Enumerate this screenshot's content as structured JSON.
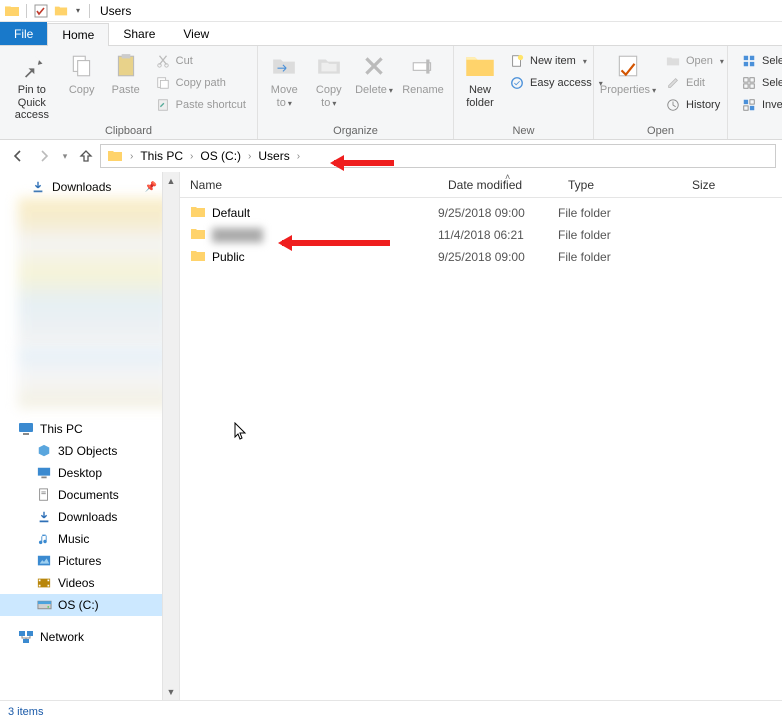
{
  "titlebar": {
    "title": "Users"
  },
  "tabs": {
    "file": "File",
    "home": "Home",
    "share": "Share",
    "view": "View"
  },
  "ribbon": {
    "clipboard": {
      "label": "Clipboard",
      "pin": "Pin to Quick access",
      "copy": "Copy",
      "paste": "Paste",
      "cut": "Cut",
      "copy_path": "Copy path",
      "paste_shortcut": "Paste shortcut"
    },
    "organize": {
      "label": "Organize",
      "move_to": "Move to",
      "copy_to": "Copy to",
      "delete": "Delete",
      "rename": "Rename"
    },
    "new": {
      "label": "New",
      "new_folder": "New folder",
      "new_item": "New item",
      "easy_access": "Easy access"
    },
    "open": {
      "label": "Open",
      "properties": "Properties",
      "open": "Open",
      "edit": "Edit",
      "history": "History"
    },
    "select": {
      "label": "",
      "select_all": "Select",
      "select_none": "Select",
      "invert": "Inver"
    }
  },
  "breadcrumbs": [
    "This PC",
    "OS (C:)",
    "Users"
  ],
  "columns": {
    "name": "Name",
    "date": "Date modified",
    "type": "Type",
    "size": "Size"
  },
  "rows": [
    {
      "name": "Default",
      "date": "9/25/2018 09:00",
      "type": "File folder"
    },
    {
      "name": "",
      "date": "11/4/2018 06:21",
      "type": "File folder",
      "blurred": true
    },
    {
      "name": "Public",
      "date": "9/25/2018 09:00",
      "type": "File folder"
    }
  ],
  "tree": {
    "downloads": "Downloads",
    "thispc": "This PC",
    "objects3d": "3D Objects",
    "desktop": "Desktop",
    "documents": "Documents",
    "downloads2": "Downloads",
    "music": "Music",
    "pictures": "Pictures",
    "videos": "Videos",
    "osc": "OS (C:)",
    "network": "Network"
  },
  "status": "3 items"
}
